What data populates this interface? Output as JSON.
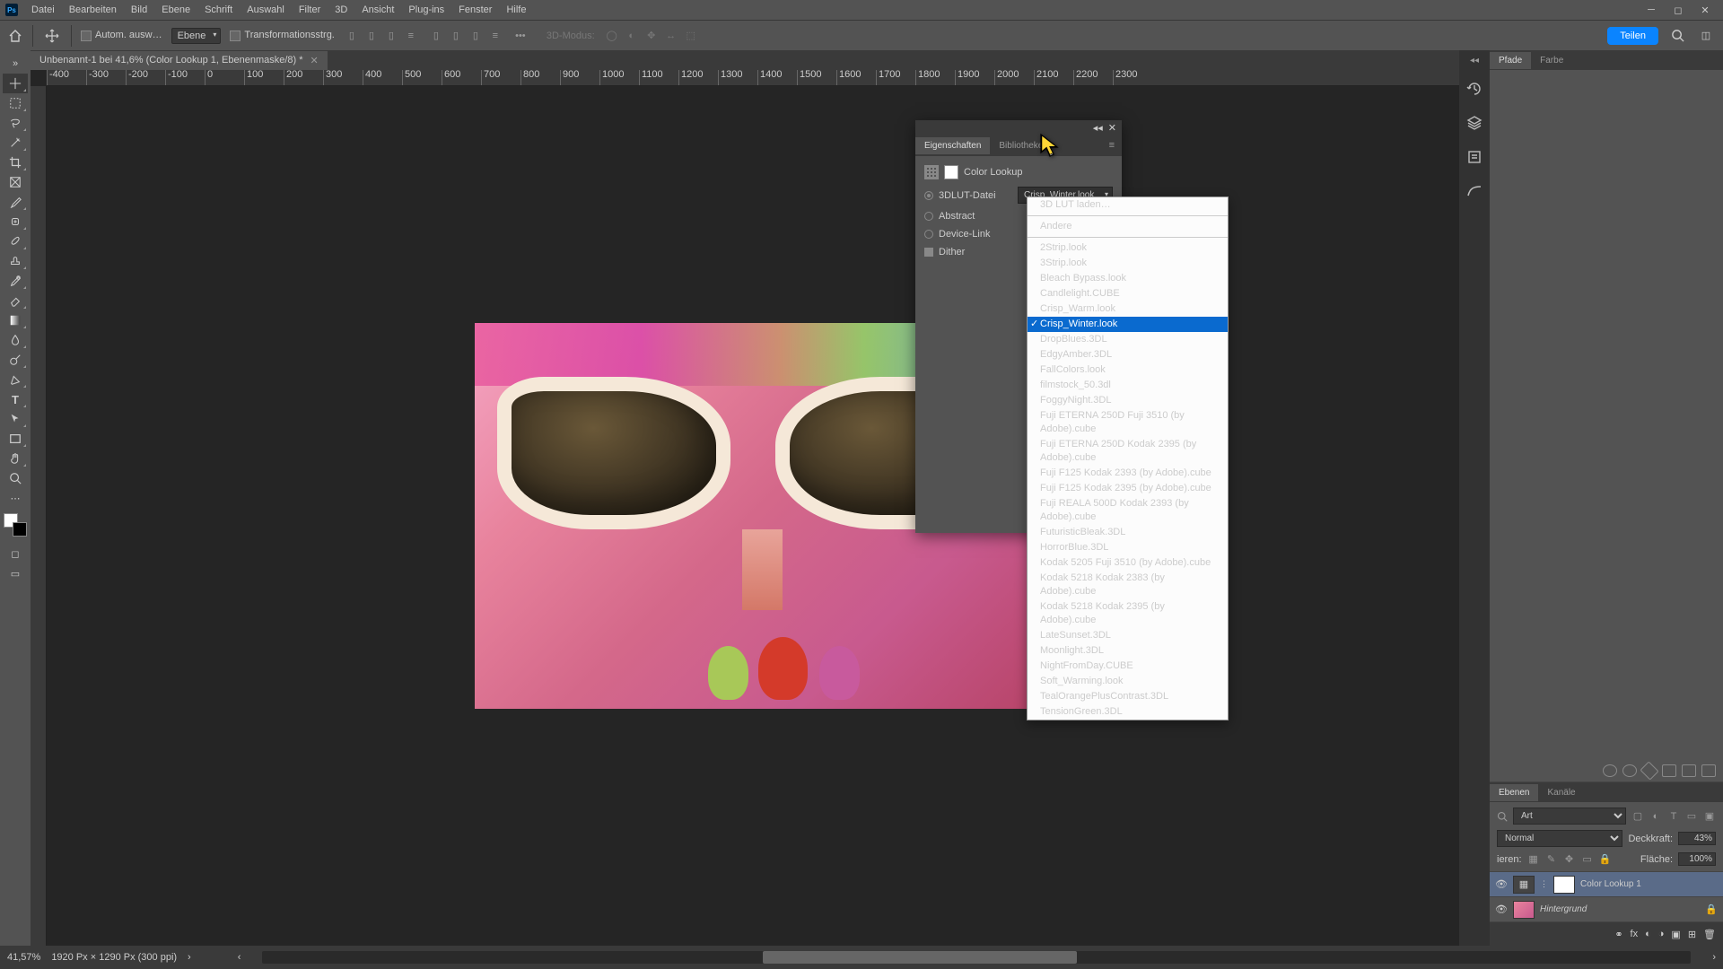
{
  "menubar": {
    "items": [
      "Datei",
      "Bearbeiten",
      "Bild",
      "Ebene",
      "Schrift",
      "Auswahl",
      "Filter",
      "3D",
      "Ansicht",
      "Plug-ins",
      "Fenster",
      "Hilfe"
    ]
  },
  "optbar": {
    "auto_select": "Autom. ausw…",
    "layer_sel": "Ebene",
    "transform": "Transformationsstrg.",
    "mode3d": "3D-Modus:",
    "share": "Teilen"
  },
  "doc": {
    "tab_title": "Unbenannt-1 bei 41,6% (Color Lookup 1, Ebenenmaske/8) *"
  },
  "ruler_ticks": [
    "-400",
    "-300",
    "-200",
    "-100",
    "0",
    "100",
    "200",
    "300",
    "400",
    "500",
    "600",
    "700",
    "800",
    "900",
    "1000",
    "1100",
    "1200",
    "1300",
    "1400",
    "1500",
    "1600",
    "1700",
    "1800",
    "1900",
    "2000",
    "2100",
    "2200",
    "2300"
  ],
  "panels": {
    "top_tabs": [
      "Pfade",
      "Farbe"
    ],
    "layers_tabs": [
      "Ebenen",
      "Kanäle"
    ],
    "search_label": "Art",
    "blend_mode": "Normal",
    "opacity_label": "Deckkraft:",
    "opacity_val": "43%",
    "lock_label": "ieren:",
    "fill_label": "Fläche:",
    "fill_val": "100%",
    "layer1": "Color Lookup 1",
    "layer2": "Hintergrund"
  },
  "float": {
    "tab1": "Eigenschaften",
    "tab2": "Bibliotheken",
    "header": "Color Lookup",
    "r1": "3DLUT-Datei",
    "r2": "Abstract",
    "r3": "Device-Link",
    "r4": "Dither",
    "selected_lut": "Crisp_Winter.look"
  },
  "dropdown": {
    "load": "3D LUT laden…",
    "other": "Andere",
    "items": [
      "2Strip.look",
      "3Strip.look",
      "Bleach Bypass.look",
      "Candlelight.CUBE",
      "Crisp_Warm.look",
      "Crisp_Winter.look",
      "DropBlues.3DL",
      "EdgyAmber.3DL",
      "FallColors.look",
      "filmstock_50.3dl",
      "FoggyNight.3DL",
      "Fuji ETERNA 250D Fuji 3510 (by Adobe).cube",
      "Fuji ETERNA 250D Kodak 2395 (by Adobe).cube",
      "Fuji F125 Kodak 2393 (by Adobe).cube",
      "Fuji F125 Kodak 2395 (by Adobe).cube",
      "Fuji REALA 500D Kodak 2393 (by Adobe).cube",
      "FuturisticBleak.3DL",
      "HorrorBlue.3DL",
      "Kodak 5205 Fuji 3510 (by Adobe).cube",
      "Kodak 5218 Kodak 2383 (by Adobe).cube",
      "Kodak 5218 Kodak 2395 (by Adobe).cube",
      "LateSunset.3DL",
      "Moonlight.3DL",
      "NightFromDay.CUBE",
      "Soft_Warming.look",
      "TealOrangePlusContrast.3DL",
      "TensionGreen.3DL"
    ],
    "selected_index": 5
  },
  "status": {
    "zoom": "41,57%",
    "dims": "1920 Px × 1290 Px (300 ppi)"
  }
}
